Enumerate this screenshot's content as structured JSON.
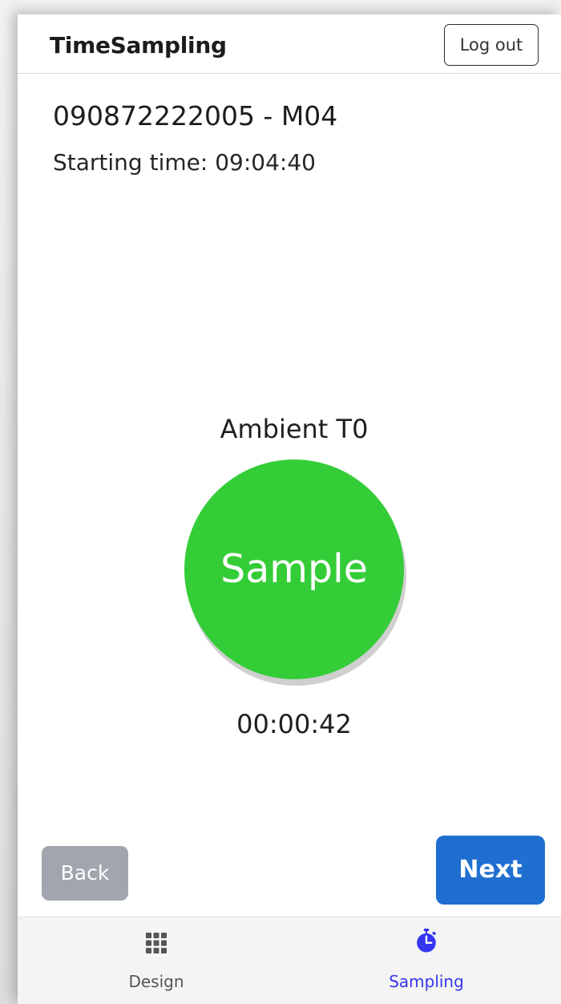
{
  "header": {
    "title": "TimeSampling",
    "logout_label": "Log out"
  },
  "main": {
    "sample_id": "090872222005 - M04",
    "starting_time": "Starting time: 09:04:40",
    "point_label": "Ambient T0",
    "sample_button_label": "Sample",
    "timer": "00:00:42",
    "sample_button_color": "#34cd38"
  },
  "footer_buttons": {
    "back_label": "Back",
    "next_label": "Next",
    "next_color": "#1f6fd0",
    "back_color": "#a1a6ae"
  },
  "tabs": [
    {
      "label": "Design",
      "icon": "grid-icon",
      "active": false
    },
    {
      "label": "Sampling",
      "icon": "stopwatch-icon",
      "active": true
    }
  ],
  "colors": {
    "accent": "#3535f0"
  }
}
